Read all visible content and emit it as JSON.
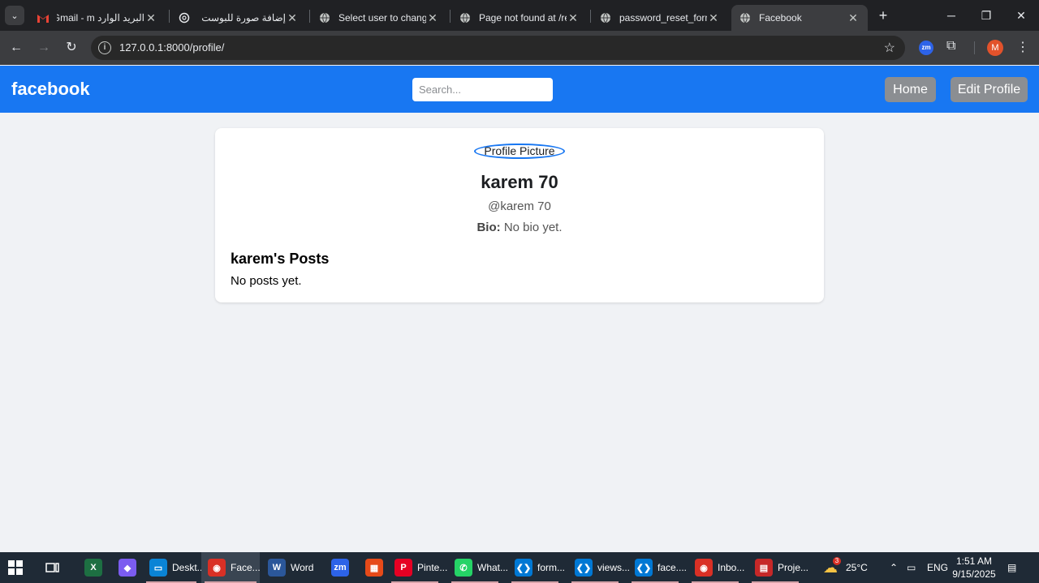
{
  "browser": {
    "tabs": [
      {
        "title": "البريد الوارد Gmail - m",
        "icon": "gmail-icon",
        "active": false
      },
      {
        "title": "إضافة صورة للبوست",
        "icon": "chatgpt-icon",
        "active": false
      },
      {
        "title": "Select user to change",
        "icon": "globe-icon",
        "active": false
      },
      {
        "title": "Page not found at /re",
        "icon": "globe-icon",
        "active": false
      },
      {
        "title": "password_reset_form",
        "icon": "globe-icon",
        "active": false
      },
      {
        "title": "Facebook",
        "icon": "globe-icon",
        "active": true
      }
    ],
    "url": "127.0.0.1:8000/profile/",
    "profile_initial": "M",
    "zoom_ext_label": "zm"
  },
  "header": {
    "logo": "facebook",
    "search_placeholder": "Search...",
    "home_label": "Home",
    "edit_profile_label": "Edit Profile"
  },
  "profile": {
    "picture_alt": "Profile Picture",
    "name": "karem 70",
    "username": "@karem 70",
    "bio_label": "Bio:",
    "bio_text": "No bio yet.",
    "posts_title": "karem's Posts",
    "no_posts": "No posts yet."
  },
  "taskbar": {
    "items": [
      {
        "label": "",
        "icon": "excel-icon",
        "color": "#1d6f42",
        "glyph": "X"
      },
      {
        "label": "",
        "icon": "copilot-icon",
        "color": "#7b5cf0",
        "glyph": "◆"
      },
      {
        "label": "Deskt...",
        "icon": "desktop-icon",
        "color": "#0a84d6",
        "glyph": "▭"
      },
      {
        "label": "Face...",
        "icon": "chrome-icon",
        "color": "#d93025",
        "glyph": "◉"
      },
      {
        "label": "Word",
        "icon": "word-icon",
        "color": "#2b579a",
        "glyph": "W"
      },
      {
        "label": "",
        "icon": "zoom-icon",
        "color": "#2d63e8",
        "glyph": "zm"
      },
      {
        "label": "",
        "icon": "store-icon",
        "color": "#e64a19",
        "glyph": "▦"
      },
      {
        "label": "Pinte...",
        "icon": "pinterest-icon",
        "color": "#e60023",
        "glyph": "P"
      },
      {
        "label": "What...",
        "icon": "whatsapp-icon",
        "color": "#25d366",
        "glyph": "✆"
      },
      {
        "label": "form...",
        "icon": "vscode-icon",
        "color": "#0078d4",
        "glyph": "❮❯"
      },
      {
        "label": "views...",
        "icon": "vscode-icon",
        "color": "#0078d4",
        "glyph": "❮❯"
      },
      {
        "label": "face....",
        "icon": "vscode-icon",
        "color": "#0078d4",
        "glyph": "❮❯"
      },
      {
        "label": "Inbo...",
        "icon": "chrome-icon",
        "color": "#d93025",
        "glyph": "◉"
      },
      {
        "label": "Proje...",
        "icon": "pdf-icon",
        "color": "#c62828",
        "glyph": "▤"
      }
    ],
    "weather": "25°C",
    "weather_badge": "3",
    "language": "ENG",
    "time": "1:51 AM",
    "date": "9/15/2025"
  }
}
